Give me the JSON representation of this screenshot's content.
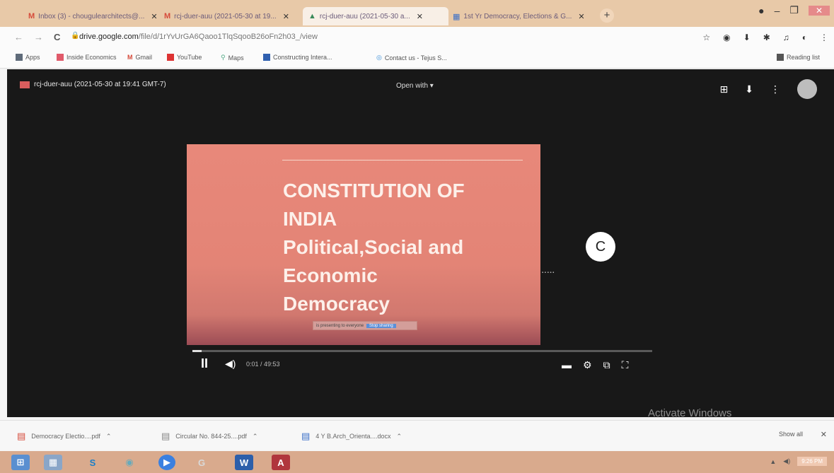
{
  "tabs": [
    {
      "icon": "M",
      "title": "Inbox (3) - chougulearchitects@..."
    },
    {
      "icon": "M",
      "title": "rcj-duer-auu (2021-05-30 at 19..."
    },
    {
      "icon": "▲",
      "title": "rcj-duer-auu (2021-05-30 a..."
    },
    {
      "icon": "▦",
      "title": "1st Yr Democracy, Elections & G..."
    }
  ],
  "new_tab": "+",
  "window_controls": {
    "minimize": "–",
    "maximize": "❐",
    "close": "✕"
  },
  "address": {
    "back": "←",
    "forward": "→",
    "reload": "C",
    "lock": "🔒",
    "url_host": "drive.google.com",
    "url_path": "/file/d/1rYvUrGA6Qaoo1TlqSqooB26oFn2h03_/view"
  },
  "bookmarks": [
    {
      "label": "Apps",
      "color": "#5f6b7a"
    },
    {
      "label": "Inside Economics",
      "color": "#e05a6a"
    },
    {
      "label": "Gmail",
      "color": "#d54a3a"
    },
    {
      "label": "YouTube",
      "color": "#d33"
    },
    {
      "label": "Maps",
      "color": "#5a8"
    },
    {
      "label": "Constructing Intera...",
      "color": "#3060b0"
    },
    {
      "label": "Contact us - Tejus S...",
      "color": "#3a8fd8"
    }
  ],
  "reading_list": "Reading list",
  "viewer": {
    "file_name": "rcj-duer-auu (2021-05-30 at 19:41 GMT-7)",
    "open_with": "Open with ▾",
    "presenter_initial": "C"
  },
  "slide": {
    "title_lines": [
      "CONSTITUTION OF",
      "INDIA",
      "Political,Social and",
      "Economic",
      "Democracy"
    ],
    "bar_text": "is presenting to everyone",
    "bar_button": "Stop sharing"
  },
  "player": {
    "pause": "II",
    "volume": "◀)",
    "time": "0:01 / 49:53",
    "progress": 0.02,
    "captions": "▬",
    "settings": "⚙",
    "pip": "⧉",
    "fullscreen": "⛶"
  },
  "watermark": "Activate Windows",
  "downloads": [
    {
      "name": "Democracy Electio....pdf"
    },
    {
      "name": "Circular No. 844-25....pdf"
    },
    {
      "name": "4 Y B.Arch_Orienta....docx"
    }
  ],
  "show_all": "Show all",
  "tray": {
    "time": "9:26 PM"
  }
}
